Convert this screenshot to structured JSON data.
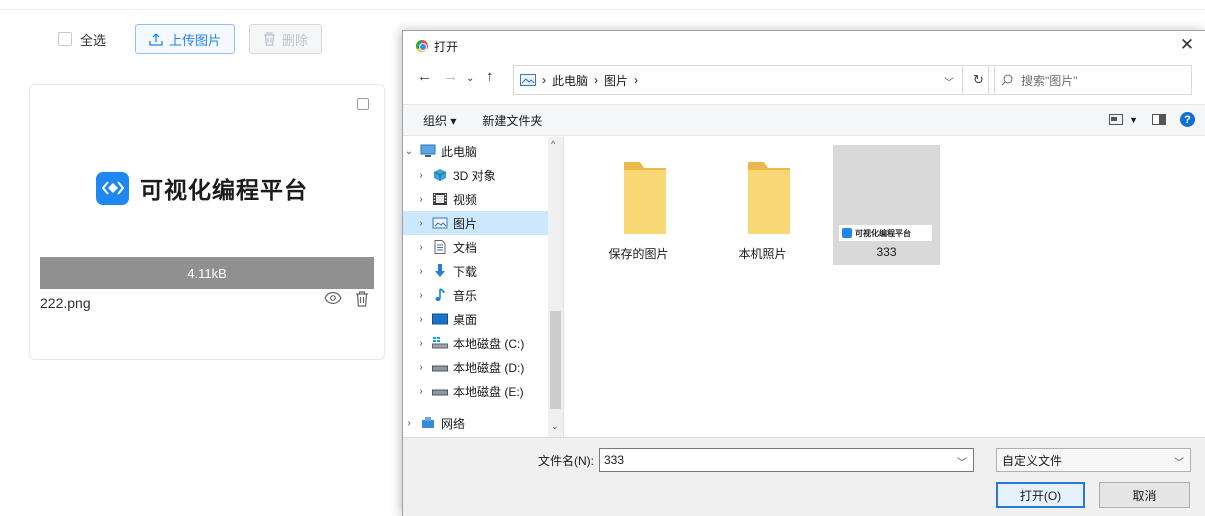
{
  "toolbar": {
    "select_all_label": "全选",
    "upload_label": "上传图片",
    "delete_label": "删除"
  },
  "card": {
    "logo_text": "可视化编程平台",
    "size": "4.11kB",
    "file_name": "222.png"
  },
  "dialog": {
    "title": "打开",
    "path": [
      "此电脑",
      "图片"
    ],
    "search_placeholder": "搜索\"图片\"",
    "organize_label": "组织 ▾",
    "new_folder_label": "新建文件夹",
    "tree": [
      {
        "label": "此电脑",
        "icon": "computer-icon",
        "expanded": true
      },
      {
        "label": "3D 对象",
        "icon": "cube-3d-icon"
      },
      {
        "label": "视频",
        "icon": "video-icon"
      },
      {
        "label": "图片",
        "icon": "picture-icon",
        "selected": true
      },
      {
        "label": "文档",
        "icon": "document-icon"
      },
      {
        "label": "下载",
        "icon": "download-arrow-icon"
      },
      {
        "label": "音乐",
        "icon": "music-note-icon"
      },
      {
        "label": "桌面",
        "icon": "desktop-icon"
      },
      {
        "label": "本地磁盘 (C:)",
        "icon": "drive-icon"
      },
      {
        "label": "本地磁盘 (D:)",
        "icon": "drive-icon"
      },
      {
        "label": "本地磁盘 (E:)",
        "icon": "drive-icon"
      },
      {
        "label": "网络",
        "icon": "network-icon"
      }
    ],
    "items": [
      {
        "label": "保存的图片",
        "type": "folder"
      },
      {
        "label": "本机照片",
        "type": "folder"
      },
      {
        "label": "333",
        "type": "image",
        "thumb_text": "可视化编程平台",
        "selected": true
      }
    ],
    "filename_label": "文件名(N):",
    "filename_value": "333",
    "filetype_value": "自定义文件",
    "open_label": "打开(O)",
    "cancel_label": "取消"
  },
  "colors": {
    "accent": "#1e86f5",
    "selection": "#cce8ff",
    "folder": "#f8d775"
  }
}
